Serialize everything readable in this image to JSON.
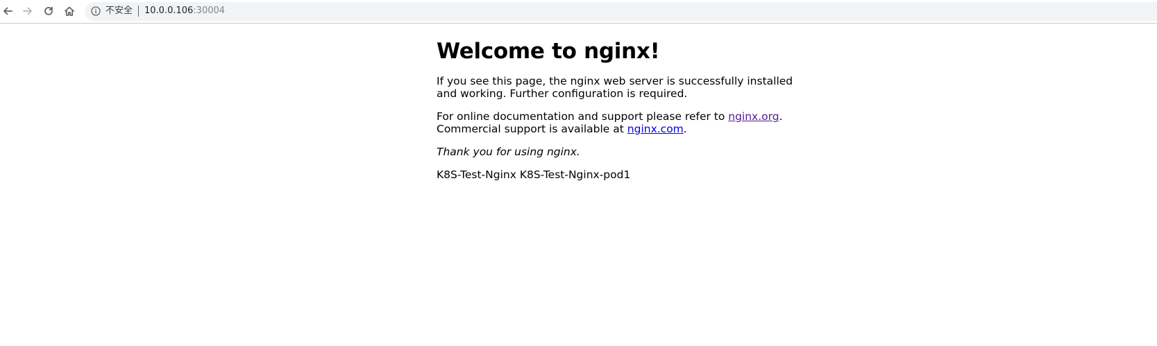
{
  "browser": {
    "back_icon": "arrow-left-icon",
    "forward_icon": "arrow-right-icon",
    "reload_icon": "reload-icon",
    "home_icon": "home-icon",
    "info_icon": "info-circle-icon",
    "security_label": "不安全",
    "url_host": "10.0.0.106",
    "url_port": ":30004"
  },
  "page": {
    "heading": "Welcome to nginx!",
    "para1": "If you see this page, the nginx web server is successfully installed and working. Further configuration is required.",
    "para2_prefix": "For online documentation and support please refer to ",
    "link_org": "nginx.org",
    "para2_mid": ". Commercial support is available at ",
    "link_com": "nginx.com",
    "para2_suffix": ".",
    "thanks": "Thank you for using nginx.",
    "footer_text": "K8S-Test-Nginx K8S-Test-Nginx-pod1"
  },
  "colors": {
    "link_visited": "#551a8b",
    "link_unvisited": "#0000ee",
    "omnibox_bg": "#f1f3f4"
  }
}
